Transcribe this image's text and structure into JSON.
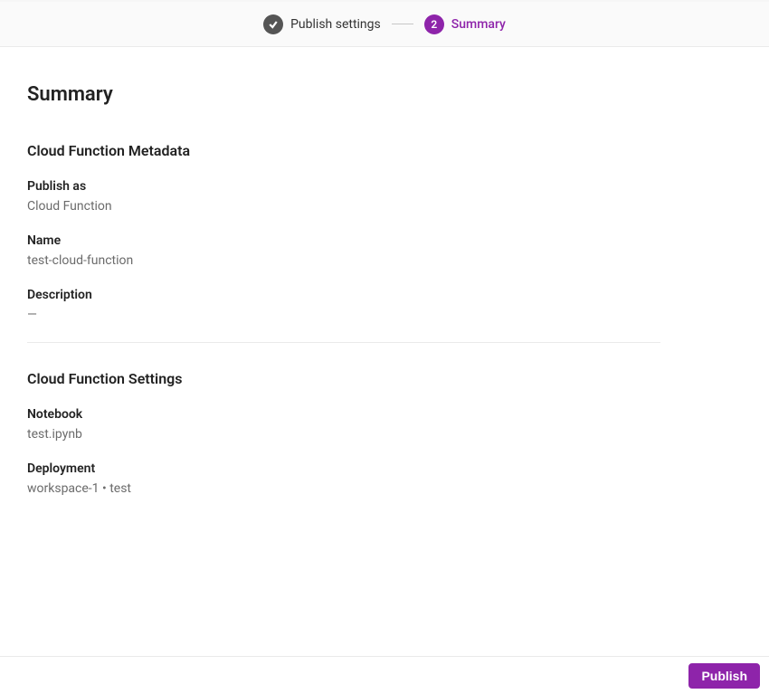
{
  "stepper": {
    "step1": {
      "label": "Publish settings"
    },
    "step2": {
      "number": "2",
      "label": "Summary"
    }
  },
  "page": {
    "title": "Summary"
  },
  "metadata": {
    "section_title": "Cloud Function Metadata",
    "publish_as": {
      "label": "Publish as",
      "value": "Cloud Function"
    },
    "name": {
      "label": "Name",
      "value": "test-cloud-function"
    },
    "description": {
      "label": "Description",
      "value": "—"
    }
  },
  "settings": {
    "section_title": "Cloud Function Settings",
    "notebook": {
      "label": "Notebook",
      "value": "test.ipynb"
    },
    "deployment": {
      "label": "Deployment",
      "value": "workspace-1 • test"
    }
  },
  "footer": {
    "publish_label": "Publish"
  }
}
